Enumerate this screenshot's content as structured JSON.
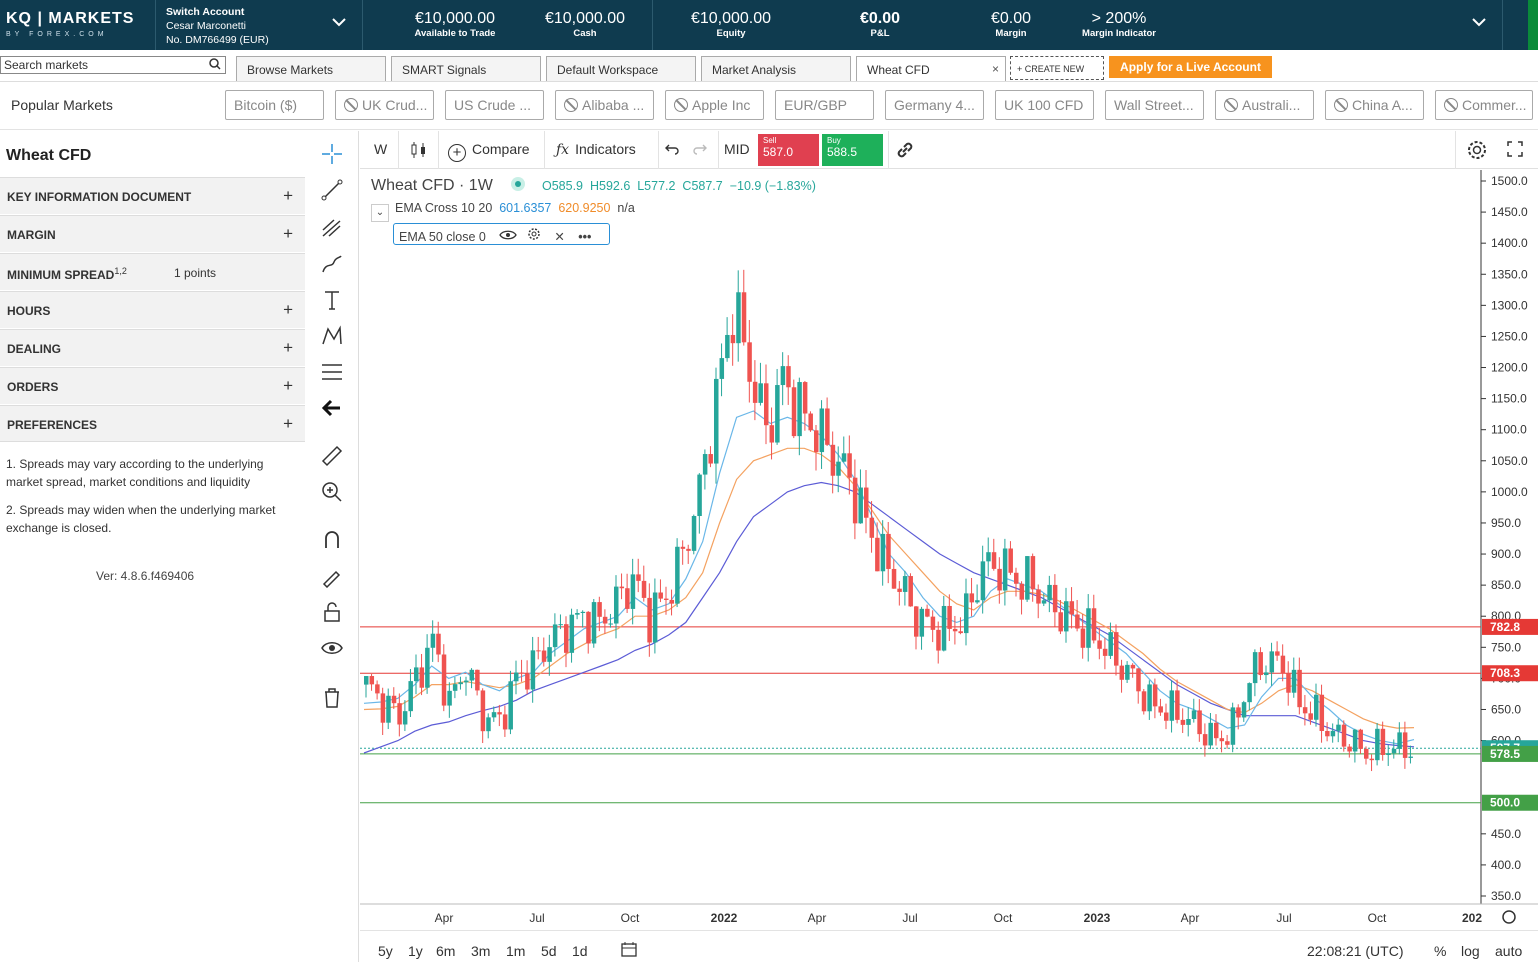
{
  "brand": {
    "name": "KQ | MARKETS",
    "sub": "BY FOREX.COM"
  },
  "account": {
    "switch_label": "Switch Account",
    "user_name": "Cesar Marconetti",
    "account_no": "No. DM766499 (EUR)"
  },
  "stats": [
    {
      "value": "€10,000.00",
      "label": "Available to Trade"
    },
    {
      "value": "€10,000.00",
      "label": "Cash"
    },
    {
      "value": "€10,000.00",
      "label": "Equity"
    },
    {
      "value": "€0.00",
      "label": "P&L"
    },
    {
      "value": "€0.00",
      "label": "Margin"
    },
    {
      "value": "> 200%",
      "label": "Margin Indicator"
    }
  ],
  "search": {
    "placeholder": "Search markets"
  },
  "tabs": [
    "Browse Markets",
    "SMART Signals",
    "Default Workspace",
    "Market Analysis",
    "Wheat CFD"
  ],
  "create_new": "+ CREATE NEW",
  "apply_button": "Apply for a Live Account",
  "popular": {
    "label": "Popular Markets",
    "items": [
      "Bitcoin ($)",
      "UK Crud...",
      "US Crude ...",
      "Alibaba ...",
      "Apple Inc",
      "EUR/GBP",
      "Germany 4...",
      "UK 100 CFD",
      "Wall Street...",
      "Australi...",
      "China A...",
      "Commer..."
    ]
  },
  "left_panel": {
    "title": "Wheat CFD",
    "rows": [
      "KEY INFORMATION DOCUMENT",
      "MARGIN",
      "MINIMUM SPREAD",
      "HOURS",
      "DEALING",
      "ORDERS",
      "PREFERENCES"
    ],
    "spread_sup": "1,2",
    "spread_value": "1 points",
    "note1": "1. Spreads may vary according to the underlying market spread, market conditions and liquidity",
    "note2": "2. Spreads may widen when the underlying market exchange is closed.",
    "version": "Ver: 4.8.6.f469406"
  },
  "chart_toolbar": {
    "interval": "W",
    "compare": "Compare",
    "indicators": "Indicators",
    "mid": "MID",
    "sell_label": "Sell",
    "sell_price": "587.0",
    "buy_label": "Buy",
    "buy_price": "588.5"
  },
  "legend": {
    "symbol": "Wheat CFD · 1W",
    "o": "O585.9",
    "h": "H592.6",
    "l": "L577.2",
    "c": "C587.7",
    "chg": "−10.9 (−1.83%)",
    "ema_cross": "EMA Cross 10 20",
    "ema_v1": "601.6357",
    "ema_v2": "620.9250",
    "ema_na": "n/a",
    "ema50": "EMA 50 close 0"
  },
  "bottom_bar": {
    "ranges": [
      "5y",
      "1y",
      "6m",
      "3m",
      "1m",
      "5d",
      "1d"
    ],
    "time": "22:08:21 (UTC)",
    "percent": "%",
    "log": "log",
    "auto": "auto"
  },
  "colors": {
    "up": "#26a69a",
    "down": "#ef5350",
    "ema10": "#6ab7e8",
    "ema20": "#f4a261",
    "ema50": "#5c5cd6",
    "red_line": "#e53935",
    "green_line": "#43a047",
    "topbar": "#0f3b4f",
    "apply": "#f7931e"
  },
  "chart_data": {
    "type": "candlestick",
    "y_axis": {
      "min": 350,
      "max": 1500,
      "ticks": [
        "1500.0",
        "1450.0",
        "1400.0",
        "1350.0",
        "1300.0",
        "1250.0",
        "1200.0",
        "1150.0",
        "1100.0",
        "1050.0",
        "1000.0",
        "950.0",
        "900.0",
        "850.0",
        "800.0",
        "750.0",
        "700.0",
        "650.0",
        "600.0",
        "450.0",
        "400.0",
        "350.0"
      ]
    },
    "x_axis": {
      "labels": [
        "Apr",
        "Jul",
        "Oct",
        "2022",
        "Apr",
        "Jul",
        "Oct",
        "2023",
        "Apr",
        "Jul",
        "Oct",
        "202"
      ]
    },
    "price_tags": [
      {
        "value": 782.8,
        "label": "782.8",
        "color": "#e53935"
      },
      {
        "value": 708.3,
        "label": "708.3",
        "color": "#e53935"
      },
      {
        "value": 587.7,
        "label": "587.7",
        "color": "#26a69a"
      },
      {
        "value": 578.5,
        "label": "578.5",
        "color": "#43a047"
      },
      {
        "value": 500.0,
        "label": "500.0",
        "color": "#43a047"
      }
    ],
    "close_path": [
      690,
      660,
      640,
      700,
      760,
      660,
      720,
      640,
      630,
      700,
      720,
      760,
      780,
      800,
      790,
      820,
      860,
      800,
      830,
      900,
      1000,
      1150,
      1300,
      1200,
      1100,
      1180,
      1130,
      1100,
      1060,
      1020,
      950,
      890,
      850,
      800,
      780,
      780,
      800,
      880,
      880,
      860,
      850,
      820,
      800,
      780,
      760,
      730,
      700,
      660,
      650,
      640,
      620,
      600,
      620,
      700,
      730,
      720,
      660,
      640,
      610,
      600,
      580,
      590,
      588
    ],
    "ema10_path": [
      660,
      662,
      668,
      690,
      720,
      700,
      710,
      690,
      680,
      700,
      710,
      740,
      760,
      780,
      790,
      800,
      830,
      810,
      820,
      860,
      920,
      1030,
      1120,
      1130,
      1110,
      1120,
      1110,
      1090,
      1060,
      1020,
      960,
      900,
      870,
      830,
      800,
      790,
      800,
      840,
      860,
      850,
      840,
      820,
      800,
      780,
      760,
      740,
      710,
      680,
      660,
      650,
      635,
      620,
      625,
      670,
      700,
      700,
      670,
      650,
      625,
      610,
      600,
      595,
      601.6
    ],
    "ema20_path": [
      650,
      651,
      655,
      670,
      690,
      690,
      695,
      690,
      685,
      690,
      700,
      720,
      740,
      755,
      770,
      780,
      800,
      800,
      810,
      830,
      870,
      950,
      1020,
      1050,
      1060,
      1070,
      1070,
      1060,
      1040,
      1010,
      970,
      930,
      900,
      870,
      840,
      820,
      810,
      830,
      840,
      840,
      835,
      825,
      810,
      795,
      780,
      760,
      740,
      715,
      695,
      680,
      665,
      650,
      645,
      660,
      680,
      690,
      680,
      665,
      650,
      635,
      625,
      620,
      620.9
    ],
    "ema50_path": [
      580,
      590,
      600,
      615,
      625,
      630,
      640,
      648,
      655,
      665,
      680,
      690,
      700,
      710,
      720,
      730,
      745,
      755,
      770,
      790,
      830,
      870,
      920,
      960,
      980,
      1000,
      1010,
      1015,
      1010,
      1000,
      980,
      960,
      940,
      920,
      900,
      885,
      870,
      860,
      850,
      840,
      830,
      815,
      800,
      785,
      770,
      750,
      730,
      710,
      690,
      675,
      660,
      650,
      640,
      640,
      640,
      640,
      630,
      620,
      610,
      600,
      595,
      592,
      590
    ]
  }
}
